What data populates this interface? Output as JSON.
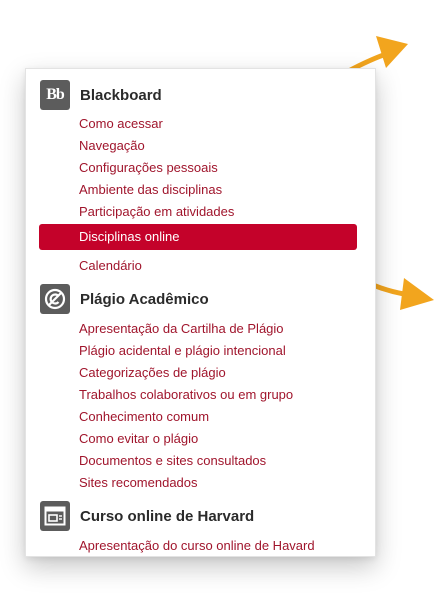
{
  "sections": [
    {
      "title": "Blackboard",
      "icon": "blackboard-logo-icon",
      "icon_text": "Bb",
      "items": [
        "Como acessar",
        "Navegação",
        "Configurações pessoais",
        "Ambiente das disciplinas",
        "Participação em atividades",
        "Disciplinas online",
        "Calendário"
      ],
      "active_item": "Disciplinas online"
    },
    {
      "title": "Plágio Acadêmico",
      "icon": "no-copyright-icon",
      "items": [
        "Apresentação da Cartilha de Plágio",
        "Plágio acidental e plágio intencional",
        "Categorizações de plágio",
        "Trabalhos colaborativos ou em grupo",
        "Conhecimento comum",
        "Como evitar o plágio",
        "Documentos e sites consultados",
        "Sites recomendados"
      ]
    },
    {
      "title": "Curso online de Harvard",
      "icon": "browser-window-icon",
      "items": [
        "Apresentação do curso online de Havard"
      ]
    }
  ],
  "colors": {
    "link": "#a0152c",
    "active_background": "#c4022a",
    "icon_background": "#5c5c5c",
    "arrow": "#f2a51e"
  },
  "decorations": [
    "orange-arrow-icon",
    "orange-arrow-icon"
  ]
}
